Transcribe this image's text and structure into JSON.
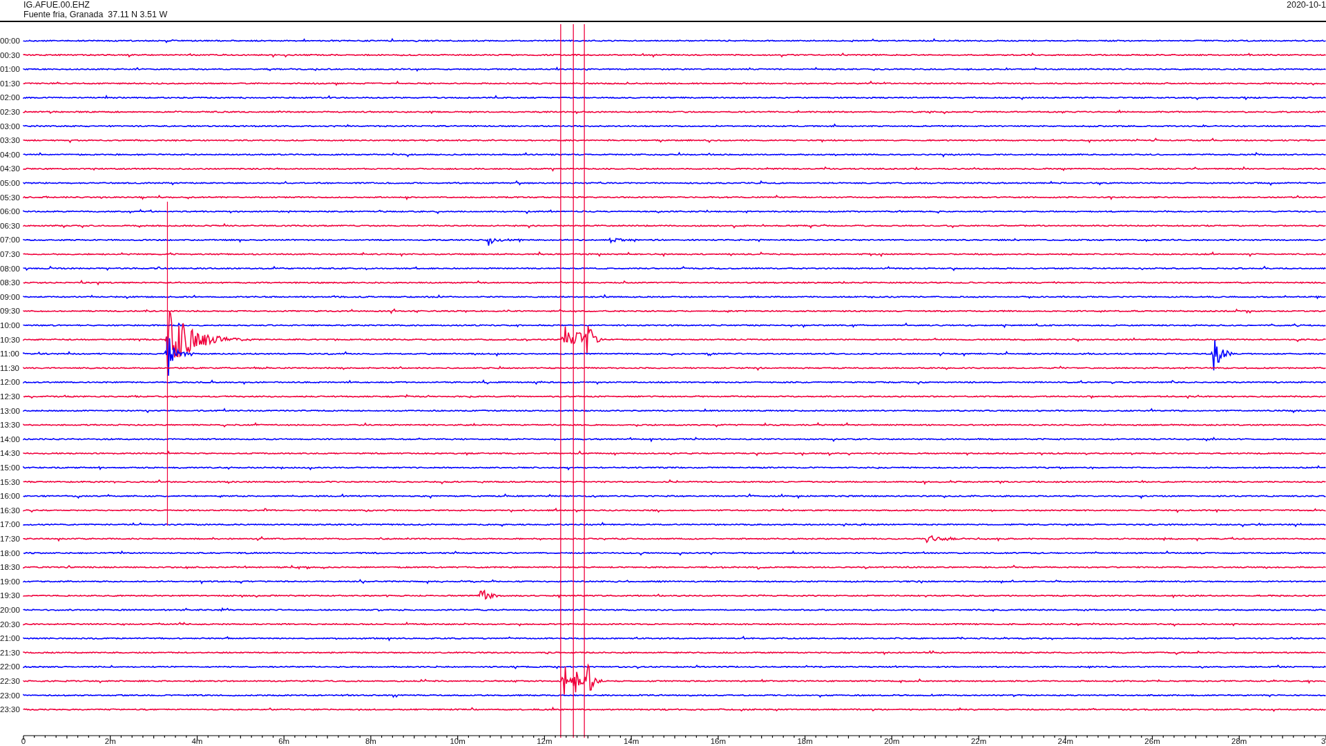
{
  "header": {
    "station": "IG.AFUE.00.EHZ",
    "location": "Fuente fria, Granada  37.11 N 3.51 W",
    "date": "2020-10-1"
  },
  "traces": [
    {
      "time": "00:00",
      "color": "#0000ff"
    },
    {
      "time": "00:30",
      "color": "#f0003c"
    },
    {
      "time": "01:00",
      "color": "#0000ff"
    },
    {
      "time": "01:30",
      "color": "#f0003c"
    },
    {
      "time": "02:00",
      "color": "#0000ff"
    },
    {
      "time": "02:30",
      "color": "#f0003c"
    },
    {
      "time": "03:00",
      "color": "#0000ff"
    },
    {
      "time": "03:30",
      "color": "#f0003c"
    },
    {
      "time": "04:00",
      "color": "#0000ff"
    },
    {
      "time": "04:30",
      "color": "#f0003c"
    },
    {
      "time": "05:00",
      "color": "#0000ff"
    },
    {
      "time": "05:30",
      "color": "#f0003c"
    },
    {
      "time": "06:00",
      "color": "#0000ff"
    },
    {
      "time": "06:30",
      "color": "#f0003c"
    },
    {
      "time": "07:00",
      "color": "#0000ff"
    },
    {
      "time": "07:30",
      "color": "#f0003c"
    },
    {
      "time": "08:00",
      "color": "#0000ff"
    },
    {
      "time": "08:30",
      "color": "#f0003c"
    },
    {
      "time": "09:00",
      "color": "#0000ff"
    },
    {
      "time": "09:30",
      "color": "#f0003c"
    },
    {
      "time": "10:00",
      "color": "#0000ff"
    },
    {
      "time": "10:30",
      "color": "#f0003c"
    },
    {
      "time": "11:00",
      "color": "#0000ff"
    },
    {
      "time": "11:30",
      "color": "#f0003c"
    },
    {
      "time": "12:00",
      "color": "#0000ff"
    },
    {
      "time": "12:30",
      "color": "#f0003c"
    },
    {
      "time": "13:00",
      "color": "#0000ff"
    },
    {
      "time": "13:30",
      "color": "#f0003c"
    },
    {
      "time": "14:00",
      "color": "#0000ff"
    },
    {
      "time": "14:30",
      "color": "#f0003c"
    },
    {
      "time": "15:00",
      "color": "#0000ff"
    },
    {
      "time": "15:30",
      "color": "#f0003c"
    },
    {
      "time": "16:00",
      "color": "#0000ff"
    },
    {
      "time": "16:30",
      "color": "#f0003c"
    },
    {
      "time": "17:00",
      "color": "#0000ff"
    },
    {
      "time": "17:30",
      "color": "#f0003c"
    },
    {
      "time": "18:00",
      "color": "#0000ff"
    },
    {
      "time": "18:30",
      "color": "#f0003c"
    },
    {
      "time": "19:00",
      "color": "#0000ff"
    },
    {
      "time": "19:30",
      "color": "#f0003c"
    },
    {
      "time": "20:00",
      "color": "#0000ff"
    },
    {
      "time": "20:30",
      "color": "#f0003c"
    },
    {
      "time": "21:00",
      "color": "#0000ff"
    },
    {
      "time": "21:30",
      "color": "#f0003c"
    },
    {
      "time": "22:00",
      "color": "#0000ff"
    },
    {
      "time": "22:30",
      "color": "#f0003c"
    },
    {
      "time": "23:00",
      "color": "#0000ff"
    },
    {
      "time": "23:30",
      "color": "#f0003c"
    }
  ],
  "x_axis": {
    "tick_labels": [
      "0",
      "2m",
      "4m",
      "6m",
      "8m",
      "10m",
      "12m",
      "14m",
      "16m",
      "18m",
      "20m",
      "22m",
      "24m",
      "26m",
      "28m",
      "3"
    ]
  }
}
